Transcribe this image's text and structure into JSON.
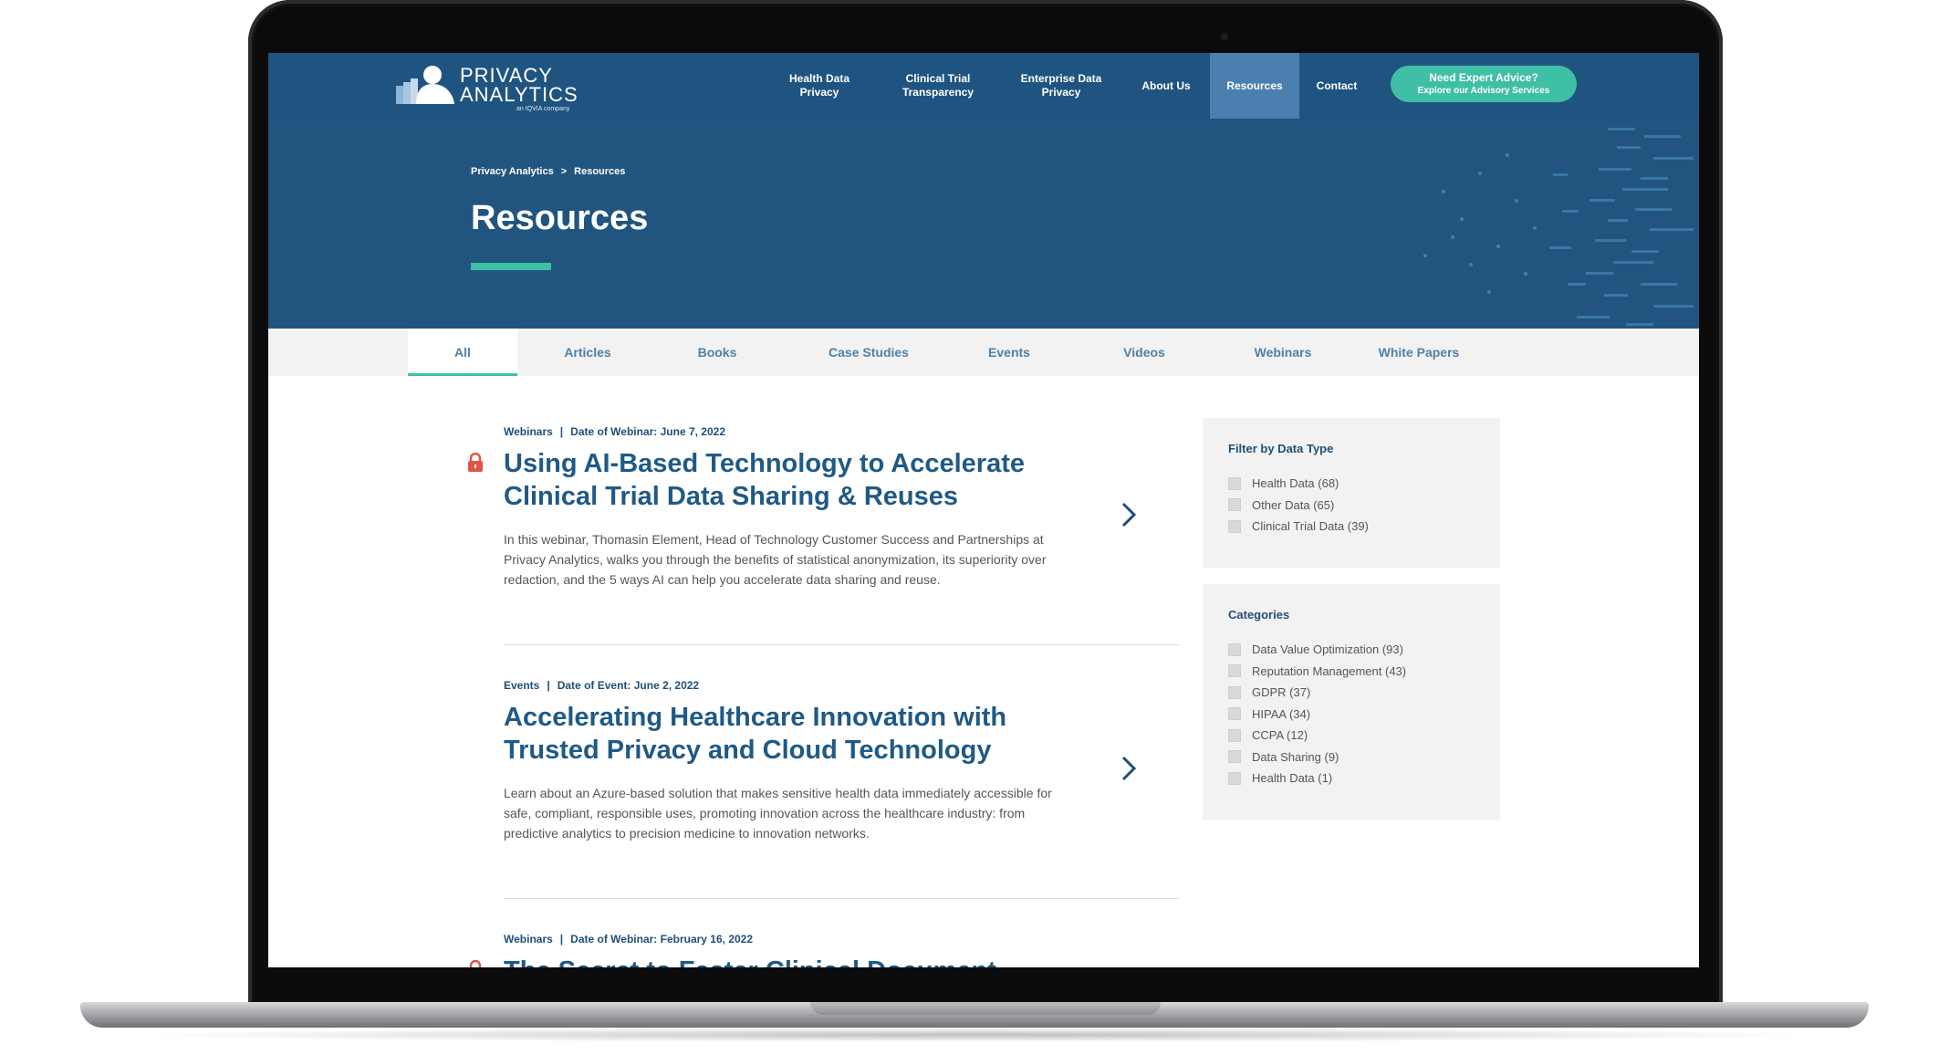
{
  "header": {
    "logo": {
      "line1": "PRIVACY",
      "line2": "ANALYTICS",
      "sub": "an IQVIA company"
    },
    "nav": [
      {
        "label": "Health Data\nPrivacy"
      },
      {
        "label": "Clinical Trial\nTransparency"
      },
      {
        "label": "Enterprise Data\nPrivacy"
      },
      {
        "label": "About Us"
      },
      {
        "label": "Resources",
        "active": true
      },
      {
        "label": "Contact"
      }
    ],
    "cta": {
      "line1": "Need Expert Advice?",
      "line2": "Explore our Advisory Services"
    }
  },
  "hero": {
    "breadcrumb": {
      "home": "Privacy Analytics",
      "separator": ">",
      "current": "Resources"
    },
    "title": "Resources"
  },
  "tabs": [
    {
      "label": "All",
      "active": true
    },
    {
      "label": "Articles"
    },
    {
      "label": "Books"
    },
    {
      "label": "Case Studies"
    },
    {
      "label": "Events"
    },
    {
      "label": "Videos"
    },
    {
      "label": "Webinars"
    },
    {
      "label": "White Papers"
    }
  ],
  "articles": [
    {
      "type": "Webinars",
      "date_label": "Date of Webinar: June 7, 2022",
      "title": "Using AI-Based Technology to Accelerate Clinical Trial Data Sharing & Reuses",
      "description": "In this webinar, Thomasin Element, Head of Technology Customer Success and Partnerships at Privacy Analytics, walks you through the benefits of statistical anonymization, its superiority over redaction, and the 5 ways AI can help you accelerate data sharing and reuse.",
      "locked": true
    },
    {
      "type": "Events",
      "date_label": "Date of Event: June 2, 2022",
      "title": "Accelerating Healthcare Innovation with Trusted Privacy and Cloud Technology",
      "description": "Learn about an Azure-based solution that makes sensitive health data immediately accessible for safe, compliant, responsible uses, promoting innovation across the healthcare industry: from predictive analytics to precision medicine to innovation networks.",
      "locked": false
    },
    {
      "type": "Webinars",
      "date_label": "Date of Webinar: February 16, 2022",
      "title": "The Secret to Faster Clinical Document",
      "locked": true
    }
  ],
  "sidebar": {
    "data_type": {
      "title": "Filter by Data Type",
      "items": [
        "Health Data (68)",
        "Other Data (65)",
        "Clinical Trial Data (39)"
      ]
    },
    "categories": {
      "title": "Categories",
      "items": [
        "Data Value Optimization (93)",
        "Reputation Management (43)",
        "GDPR (37)",
        "HIPAA (34)",
        "CCPA (12)",
        "Data Sharing (9)",
        "Health Data (1)"
      ]
    }
  },
  "colors": {
    "header_bg": "#1f5480",
    "nav_active_bg": "#4b7fb0",
    "accent_teal": "#3fbfa6",
    "title_blue": "#1f5a86",
    "lock_red": "#e0524a"
  },
  "icons": {
    "lock": "lock-icon",
    "chevron": "chevron-right-icon",
    "checkbox": "checkbox-icon"
  }
}
